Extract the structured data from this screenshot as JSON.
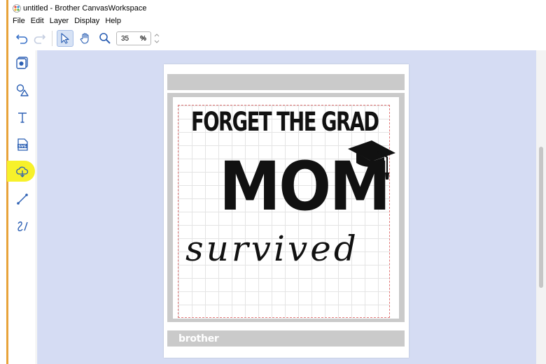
{
  "window": {
    "title": "untitled - Brother CanvasWorkspace"
  },
  "menu": {
    "items": [
      "File",
      "Edit",
      "Layer",
      "Display",
      "Help"
    ]
  },
  "toolbar": {
    "undo_icon": "undo-icon",
    "redo_icon": "redo-icon",
    "select_icon": "select-arrow-icon",
    "pan_icon": "hand-icon",
    "zoom_icon": "zoom-icon",
    "zoom_value": "35",
    "zoom_unit": "%"
  },
  "left_tools": [
    "layer-icon",
    "shapes-icon",
    "text-icon",
    "svg-icon",
    "cloud-icon",
    "line-icon",
    "freehand-icon"
  ],
  "mat": {
    "brand": "brother"
  },
  "design": {
    "line1": "FORGET THE GRAD",
    "line2": "MOM",
    "line3": "survived"
  },
  "colors": {
    "workspace": "#d5dcf3",
    "highlight": "#f7f12a",
    "window_edge": "#e8a33a",
    "select_active": "#d6e2f5"
  }
}
